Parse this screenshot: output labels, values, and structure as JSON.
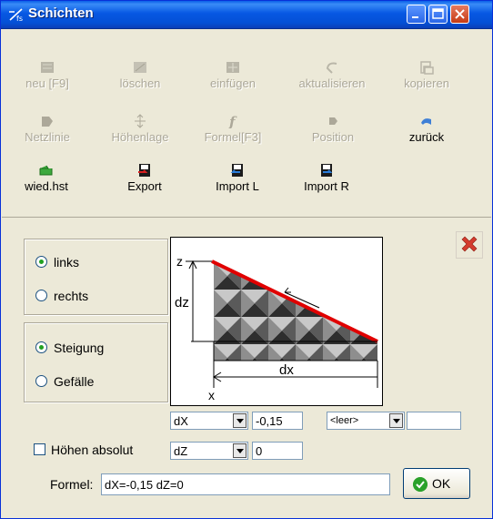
{
  "window": {
    "title": "Schichten",
    "icon": "layers-app-icon",
    "controls": [
      "minimize",
      "maximize",
      "close"
    ]
  },
  "toolbar": {
    "row1": [
      {
        "label": "neu [F9]",
        "icon": "new-layer-icon",
        "enabled": false
      },
      {
        "label": "löschen",
        "icon": "delete-layer-icon",
        "enabled": false
      },
      {
        "label": "einfügen",
        "icon": "insert-layer-icon",
        "enabled": false
      },
      {
        "label": "aktualisieren",
        "icon": "refresh-icon",
        "enabled": false
      },
      {
        "label": "kopieren",
        "icon": "copy-icon",
        "enabled": false
      }
    ],
    "row2": [
      {
        "label": "Netzlinie",
        "icon": "netline-icon",
        "enabled": false
      },
      {
        "label": "Höhenlage",
        "icon": "height-position-icon",
        "enabled": false
      },
      {
        "label": "Formel[F3]",
        "icon": "formula-icon",
        "enabled": false
      },
      {
        "label": "Position",
        "icon": "position-icon",
        "enabled": false
      },
      {
        "label": "zurück",
        "icon": "undo-icon",
        "enabled": true
      }
    ],
    "row3": [
      {
        "label": "wied.hst",
        "icon": "restore-icon",
        "enabled": true
      },
      {
        "label": "Export",
        "icon": "export-icon",
        "enabled": true
      },
      {
        "label": "Import L",
        "icon": "import-left-icon",
        "enabled": true
      },
      {
        "label": "Import R",
        "icon": "import-right-icon",
        "enabled": true
      }
    ]
  },
  "side": {
    "options": [
      {
        "label": "links",
        "selected": true
      },
      {
        "label": "rechts",
        "selected": false
      }
    ]
  },
  "slope": {
    "options": [
      {
        "label": "Steigung",
        "selected": true
      },
      {
        "label": "Gefälle",
        "selected": false
      }
    ]
  },
  "diagram": {
    "labels": {
      "z": "z",
      "dz": "dz",
      "dx": "dx",
      "x": "x"
    },
    "line_color": "#e00000"
  },
  "params": {
    "row1": {
      "select": "dX",
      "value": "-0,15",
      "extra_select": "<leer>",
      "extra_value": ""
    },
    "row2": {
      "select": "dZ",
      "value": "0"
    },
    "heights_absolute": {
      "label": "Höhen absolut",
      "checked": false
    }
  },
  "formula": {
    "label": "Formel:",
    "value": "dX=-0,15 dZ=0"
  },
  "ok_label": "OK"
}
